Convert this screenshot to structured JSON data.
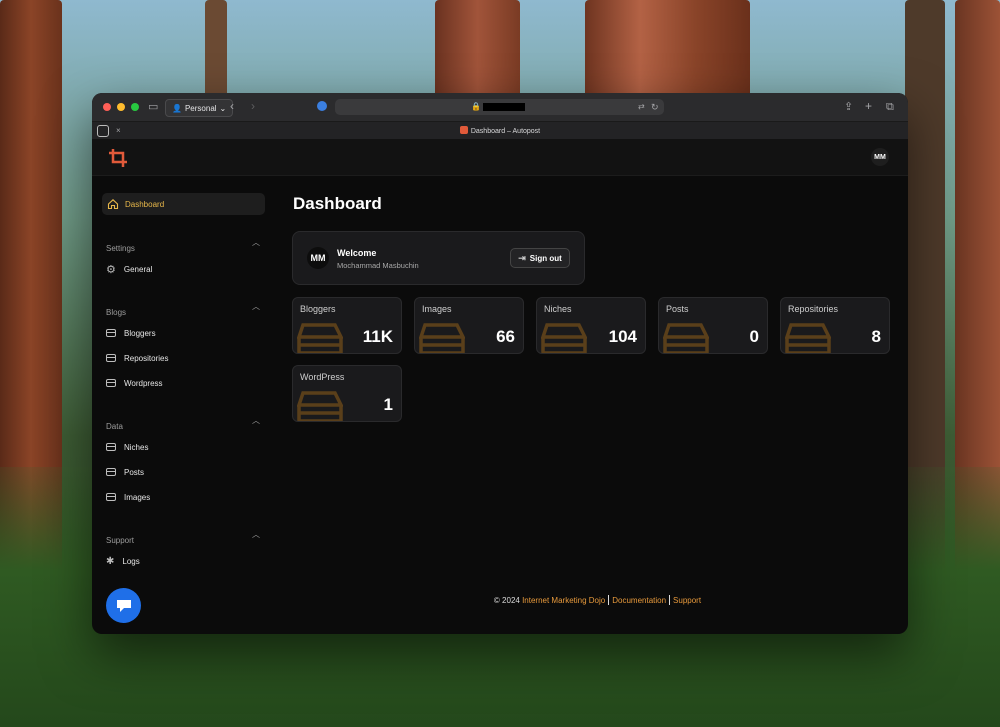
{
  "browser": {
    "profile_label": "Personal",
    "tab_title": "Dashboard – Autopost"
  },
  "header": {
    "avatar_initials": "MM"
  },
  "sidebar": {
    "active_item": "Dashboard",
    "sections": [
      {
        "title": "Settings",
        "items": [
          "General"
        ]
      },
      {
        "title": "Blogs",
        "items": [
          "Bloggers",
          "Repositories",
          "Wordpress"
        ]
      },
      {
        "title": "Data",
        "items": [
          "Niches",
          "Posts",
          "Images"
        ]
      },
      {
        "title": "Support",
        "items": [
          "Logs"
        ]
      }
    ]
  },
  "main": {
    "title": "Dashboard",
    "welcome": {
      "avatar_initials": "MM",
      "title": "Welcome",
      "user_name": "Mochammad Masbuchin",
      "sign_out_label": "Sign out"
    },
    "stats": [
      {
        "label": "Bloggers",
        "value": "11K"
      },
      {
        "label": "Images",
        "value": "66"
      },
      {
        "label": "Niches",
        "value": "104"
      },
      {
        "label": "Posts",
        "value": "0"
      },
      {
        "label": "Repositories",
        "value": "8"
      },
      {
        "label": "WordPress",
        "value": "1"
      }
    ]
  },
  "footer": {
    "prefix": "© 2024",
    "link1": "Internet Marketing Dojo",
    "link2": "Documentation",
    "link3": "Support"
  },
  "colors": {
    "accent": "#e8b84a",
    "brand": "#e15a3a",
    "link": "#e89a3c",
    "chat_button": "#1f6fe8"
  }
}
